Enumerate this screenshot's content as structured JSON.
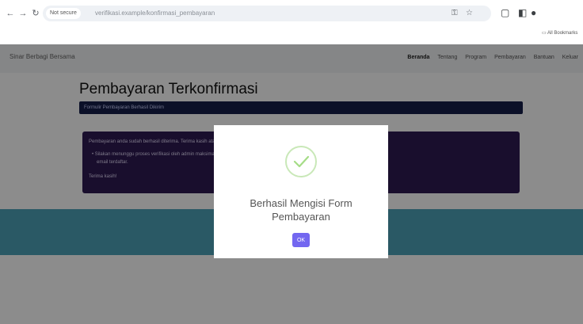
{
  "browser": {
    "site_chip": "Not secure",
    "url": "verifikasi.example/konfirmasi_pembayaran",
    "bookmarks_label": "All Bookmarks"
  },
  "site": {
    "brand": "Sinar Berbagi Bersama",
    "nav": [
      "Beranda",
      "Tentang",
      "Program",
      "Pembayaran",
      "Bantuan",
      "Keluar"
    ],
    "page_title": "Pembayaran Terkonfirmasi",
    "bar_text": "Formulir Pembayaran Berhasil Dikirim",
    "panel": {
      "line1": "Pembayaran anda sudah berhasil diterima. Terima kasih atas partisipasi Anda dalam program kami.",
      "line2": "• Silakan menunggu proses verifikasi oleh admin maksimal 1x24 jam. Jika data tidak sesuai, admin akan menghubungi Anda melalui",
      "line3": "email terdaftar.",
      "line4": "Terima kasih!"
    }
  },
  "modal": {
    "title": "Berhasil Mengisi Form Pembayaran",
    "ok_label": "OK",
    "success_color": "#a5dc86",
    "button_color": "#7367f0"
  }
}
